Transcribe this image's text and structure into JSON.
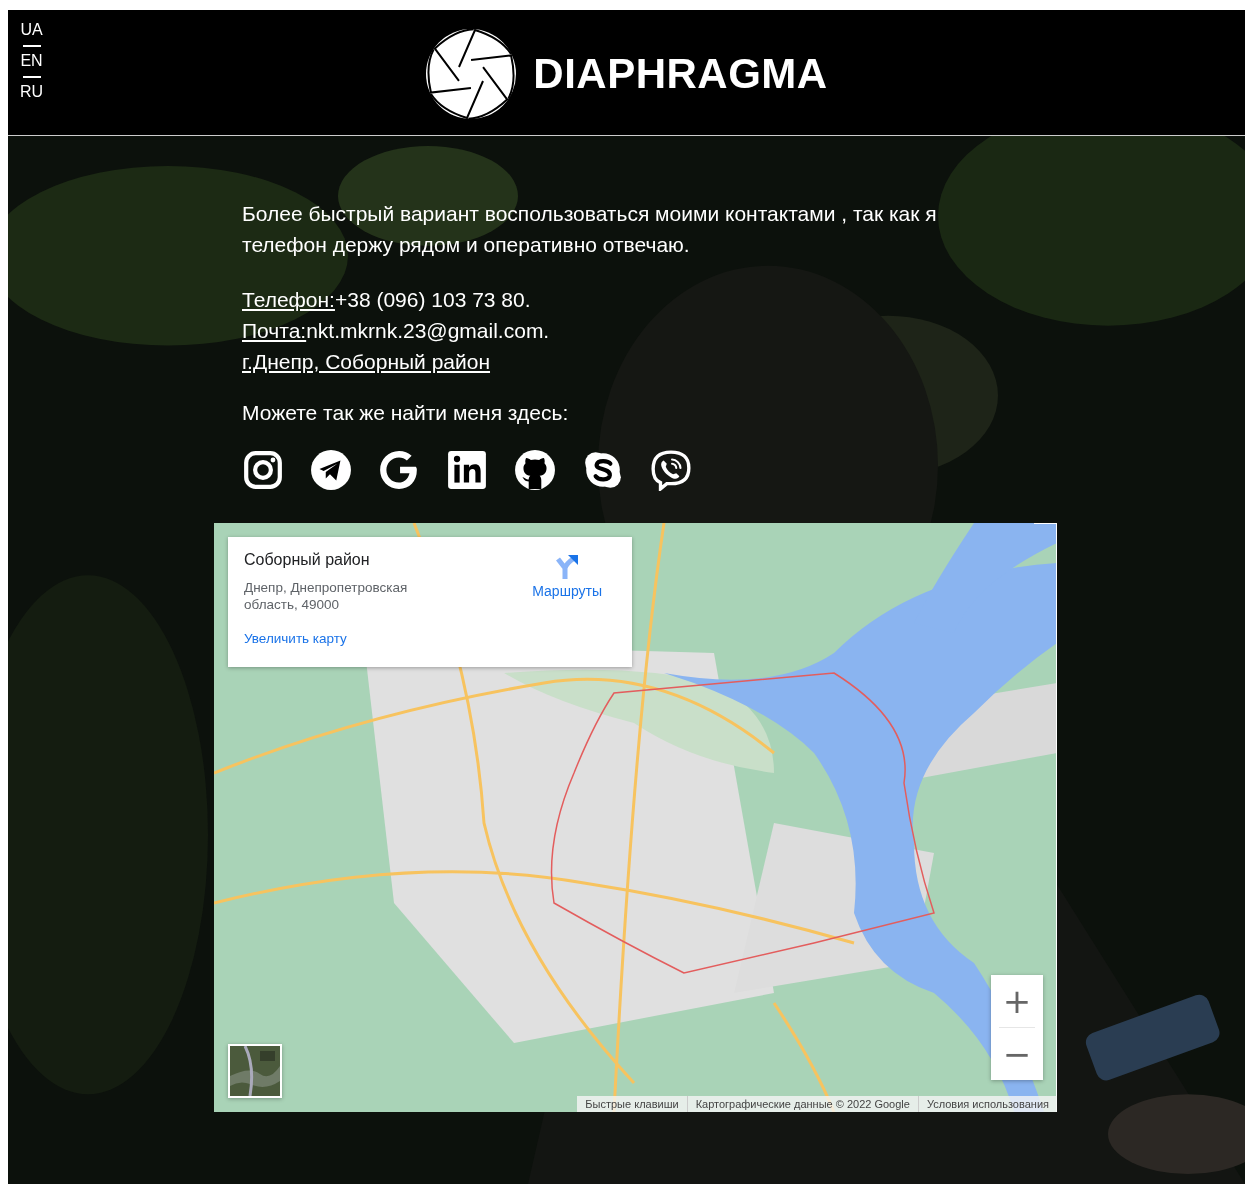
{
  "header": {
    "languages": [
      {
        "label": "UA"
      },
      {
        "label": "EN"
      },
      {
        "label": "RU"
      }
    ],
    "brand": "DIAPHRAGMA"
  },
  "contacts": {
    "intro": "Более быстрый вариант воспользоваться моими контактами , так как я телефон держу рядом и оперативно отвечаю.",
    "lines": [
      {
        "kind": "labeled",
        "label": "Телефон:",
        "value": "+38 (096) 103 73 80."
      },
      {
        "kind": "labeled",
        "label": "Почта:",
        "value": "nkt.mkrnk.23@gmail.com."
      },
      {
        "kind": "link",
        "label": "г.Днепр, Соборный район"
      }
    ],
    "find_me": "Можете так же найти меня здесь:"
  },
  "map": {
    "info_card": {
      "title": "Соборный район",
      "address": "Днепр, Днепропетровская область, 49000",
      "enlarge_link": "Увеличить карту",
      "directions": "Маршруты"
    },
    "zoom_in": "+",
    "zoom_out": "−",
    "attribution": [
      "Быстрые клавиши",
      "Картографические данные © 2022 Google",
      "Условия использования"
    ]
  }
}
